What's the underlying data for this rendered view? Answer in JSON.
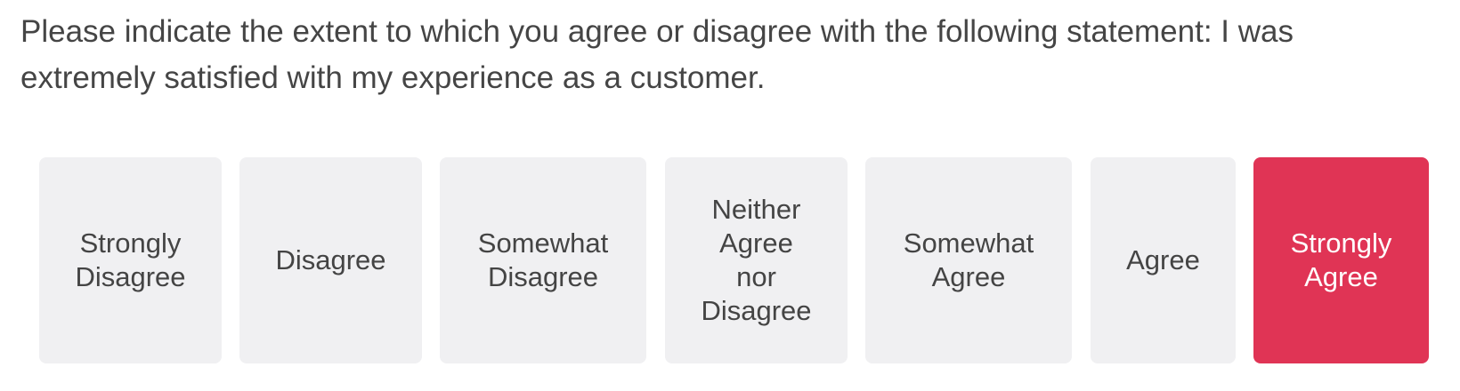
{
  "question": {
    "text": "Please indicate the extent to which you agree or disagree with the following statement: I was extremely satisfied with my experience as a customer."
  },
  "choices": [
    {
      "label": "Strongly\nDisagree",
      "selected": false
    },
    {
      "label": "Disagree",
      "selected": false
    },
    {
      "label": "Somewhat\nDisagree",
      "selected": false
    },
    {
      "label": "Neither\nAgree\nnor\nDisagree",
      "selected": false
    },
    {
      "label": "Somewhat\nAgree",
      "selected": false
    },
    {
      "label": "Agree",
      "selected": false
    },
    {
      "label": "Strongly\nAgree",
      "selected": true
    }
  ],
  "colors": {
    "option_background": "#f0f0f2",
    "selected_background": "#e03455",
    "text": "#444444",
    "selected_text": "#ffffff"
  }
}
